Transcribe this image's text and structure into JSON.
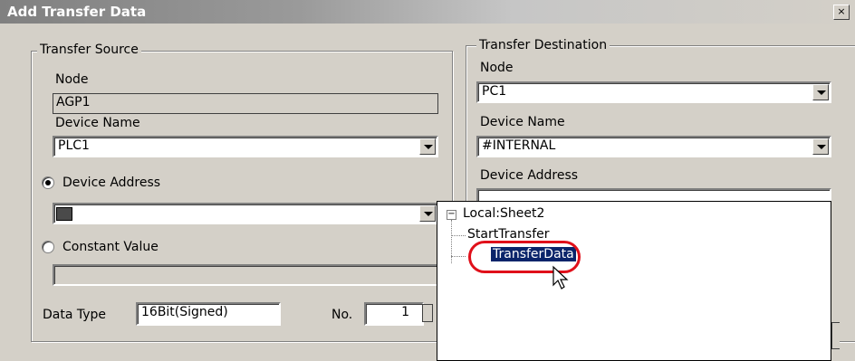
{
  "window": {
    "title": "Add Transfer Data",
    "close": "×"
  },
  "source": {
    "group_label": "Transfer Source",
    "node_label": "Node",
    "node_value": "AGP1",
    "device_name_label": "Device Name",
    "device_name_value": "PLC1",
    "device_address_label": "Device Address",
    "constant_value_label": "Constant Value",
    "data_type_label": "Data Type",
    "data_type_value": "16Bit(Signed)",
    "no_label": "No.",
    "no_value": "1"
  },
  "destination": {
    "group_label": "Transfer Destination",
    "node_label": "Node",
    "node_value": "PC1",
    "device_name_label": "Device Name",
    "device_name_value": "#INTERNAL",
    "device_address_label": "Device Address"
  },
  "tree": {
    "expander": "−",
    "root": "Local:Sheet2",
    "items": [
      "StartTransfer",
      "TransferData"
    ]
  }
}
